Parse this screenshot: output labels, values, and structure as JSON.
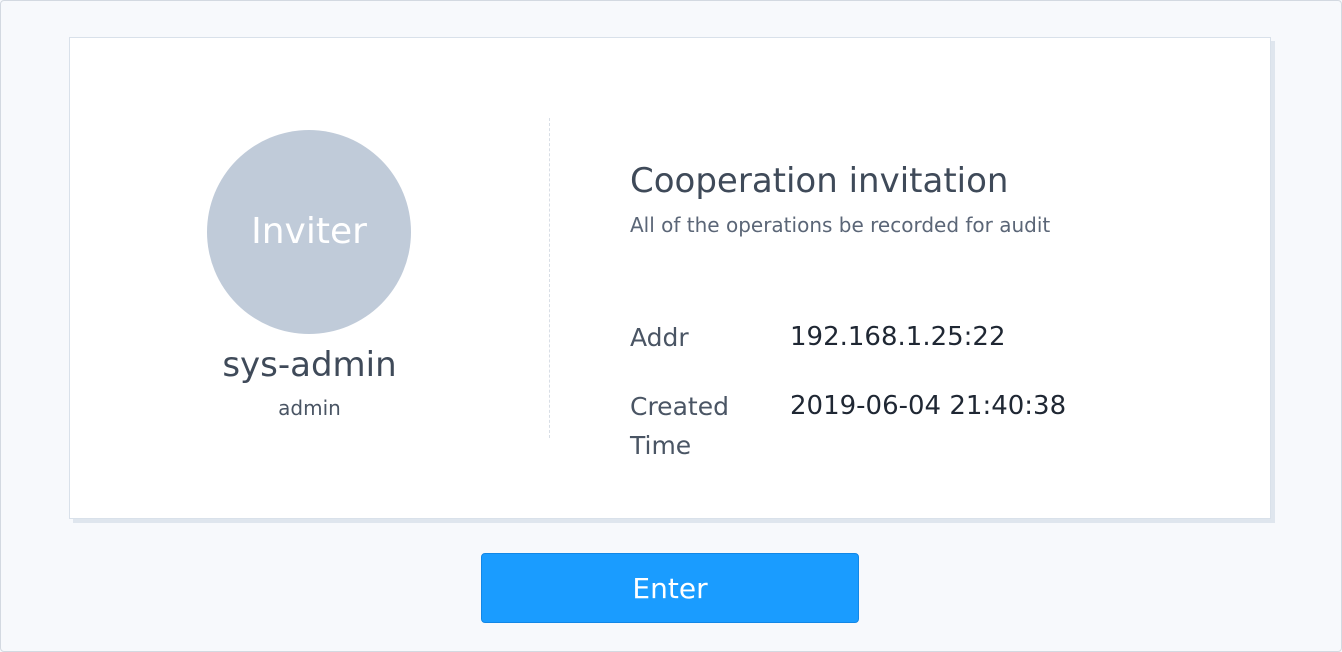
{
  "inviter": {
    "avatar_text": "Inviter",
    "username": "sys-admin",
    "role": "admin"
  },
  "invitation": {
    "title": "Cooperation invitation",
    "subtitle": "All of the operations be recorded for audit",
    "fields": [
      {
        "label": "Addr",
        "value": "192.168.1.25:22"
      },
      {
        "label": "Created Time",
        "value": "2019-06-04 21:40:38"
      }
    ]
  },
  "actions": {
    "enter_label": "Enter"
  },
  "colors": {
    "page_background": "#f7f9fc",
    "avatar_background": "#c0cbd9",
    "button_primary": "#1a9cff",
    "text_dark": "#1f2733",
    "text_muted": "#4a5564"
  }
}
